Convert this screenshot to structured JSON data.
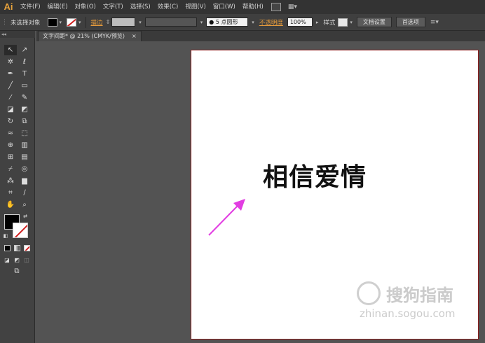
{
  "app": {
    "logo": "Ai"
  },
  "menu": {
    "items": [
      "文件(F)",
      "编辑(E)",
      "对象(O)",
      "文字(T)",
      "选择(S)",
      "效果(C)",
      "视图(V)",
      "窗口(W)",
      "帮助(H)"
    ]
  },
  "control_bar": {
    "selection_status": "未选择对象",
    "stroke_label": "描边",
    "brush_label": "5 点圆形",
    "opacity_label": "不透明度",
    "opacity_value": "100%",
    "style_label": "样式",
    "doc_setup_button": "文档设置",
    "preferences_button": "首选项",
    "colors": {
      "fill": "#000000",
      "stroke_none": "#d02020"
    }
  },
  "document": {
    "tab_title": "文字间距* @ 21% (CMYK/预览)",
    "tab_close": "×",
    "artwork_text": "相信爱情"
  },
  "watermark": {
    "brand": "搜狗指南",
    "url": "zhinan.sogou.com"
  },
  "annotation": {
    "arrow_color": "#e23de2"
  }
}
